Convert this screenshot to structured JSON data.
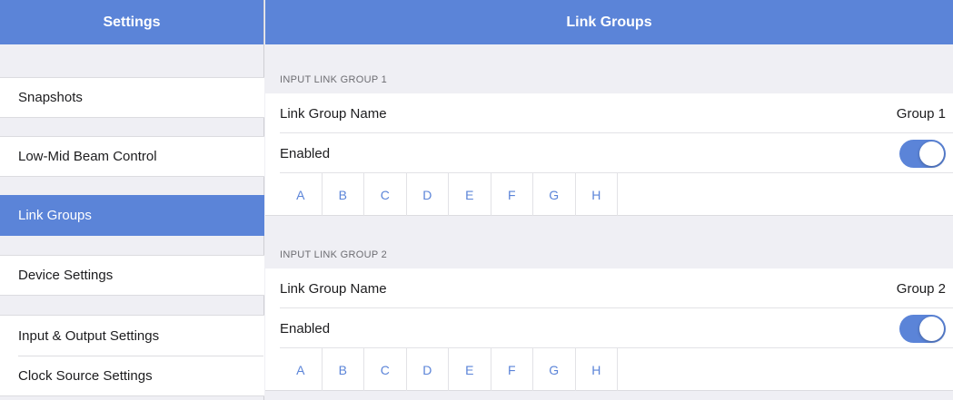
{
  "sidebar": {
    "title": "Settings",
    "items": [
      {
        "label": "Snapshots"
      },
      {
        "label": "Low-Mid Beam Control"
      },
      {
        "label": "Link Groups"
      },
      {
        "label": "Device Settings"
      },
      {
        "label": "Input & Output Settings"
      },
      {
        "label": "Clock Source Settings"
      }
    ],
    "active_index": 2
  },
  "main": {
    "title": "Link Groups",
    "groups": [
      {
        "section_title": "INPUT LINK GROUP 1",
        "name_label": "Link Group Name",
        "name_value": "Group 1",
        "enabled_label": "Enabled",
        "enabled": true,
        "channels": [
          "A",
          "B",
          "C",
          "D",
          "E",
          "F",
          "G",
          "H"
        ]
      },
      {
        "section_title": "INPUT LINK GROUP 2",
        "name_label": "Link Group Name",
        "name_value": "Group 2",
        "enabled_label": "Enabled",
        "enabled": true,
        "channels": [
          "A",
          "B",
          "C",
          "D",
          "E",
          "F",
          "G",
          "H"
        ]
      }
    ]
  },
  "colors": {
    "accent": "#5b84d8",
    "background": "#efeff4"
  }
}
